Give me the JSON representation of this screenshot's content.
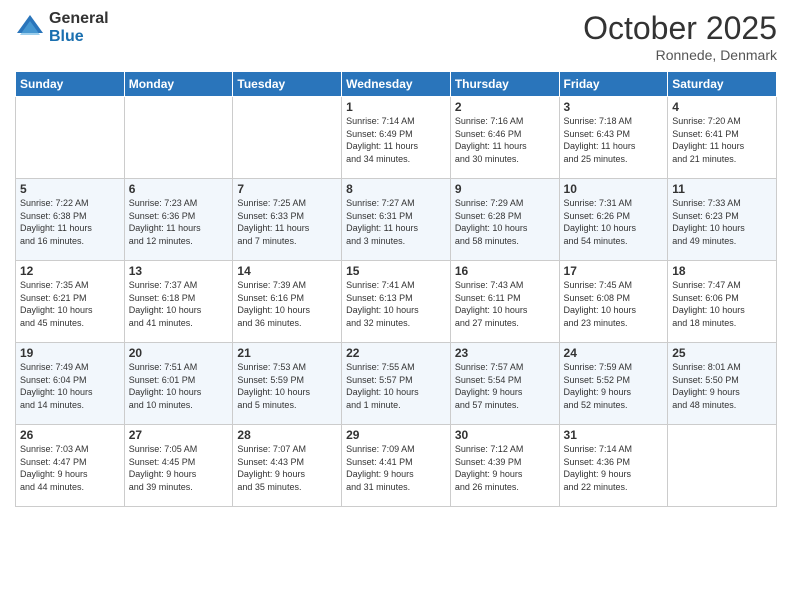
{
  "header": {
    "logo_general": "General",
    "logo_blue": "Blue",
    "month_title": "October 2025",
    "location": "Ronnede, Denmark"
  },
  "days_of_week": [
    "Sunday",
    "Monday",
    "Tuesday",
    "Wednesday",
    "Thursday",
    "Friday",
    "Saturday"
  ],
  "weeks": [
    [
      {
        "day": "",
        "info": ""
      },
      {
        "day": "",
        "info": ""
      },
      {
        "day": "",
        "info": ""
      },
      {
        "day": "1",
        "info": "Sunrise: 7:14 AM\nSunset: 6:49 PM\nDaylight: 11 hours\nand 34 minutes."
      },
      {
        "day": "2",
        "info": "Sunrise: 7:16 AM\nSunset: 6:46 PM\nDaylight: 11 hours\nand 30 minutes."
      },
      {
        "day": "3",
        "info": "Sunrise: 7:18 AM\nSunset: 6:43 PM\nDaylight: 11 hours\nand 25 minutes."
      },
      {
        "day": "4",
        "info": "Sunrise: 7:20 AM\nSunset: 6:41 PM\nDaylight: 11 hours\nand 21 minutes."
      }
    ],
    [
      {
        "day": "5",
        "info": "Sunrise: 7:22 AM\nSunset: 6:38 PM\nDaylight: 11 hours\nand 16 minutes."
      },
      {
        "day": "6",
        "info": "Sunrise: 7:23 AM\nSunset: 6:36 PM\nDaylight: 11 hours\nand 12 minutes."
      },
      {
        "day": "7",
        "info": "Sunrise: 7:25 AM\nSunset: 6:33 PM\nDaylight: 11 hours\nand 7 minutes."
      },
      {
        "day": "8",
        "info": "Sunrise: 7:27 AM\nSunset: 6:31 PM\nDaylight: 11 hours\nand 3 minutes."
      },
      {
        "day": "9",
        "info": "Sunrise: 7:29 AM\nSunset: 6:28 PM\nDaylight: 10 hours\nand 58 minutes."
      },
      {
        "day": "10",
        "info": "Sunrise: 7:31 AM\nSunset: 6:26 PM\nDaylight: 10 hours\nand 54 minutes."
      },
      {
        "day": "11",
        "info": "Sunrise: 7:33 AM\nSunset: 6:23 PM\nDaylight: 10 hours\nand 49 minutes."
      }
    ],
    [
      {
        "day": "12",
        "info": "Sunrise: 7:35 AM\nSunset: 6:21 PM\nDaylight: 10 hours\nand 45 minutes."
      },
      {
        "day": "13",
        "info": "Sunrise: 7:37 AM\nSunset: 6:18 PM\nDaylight: 10 hours\nand 41 minutes."
      },
      {
        "day": "14",
        "info": "Sunrise: 7:39 AM\nSunset: 6:16 PM\nDaylight: 10 hours\nand 36 minutes."
      },
      {
        "day": "15",
        "info": "Sunrise: 7:41 AM\nSunset: 6:13 PM\nDaylight: 10 hours\nand 32 minutes."
      },
      {
        "day": "16",
        "info": "Sunrise: 7:43 AM\nSunset: 6:11 PM\nDaylight: 10 hours\nand 27 minutes."
      },
      {
        "day": "17",
        "info": "Sunrise: 7:45 AM\nSunset: 6:08 PM\nDaylight: 10 hours\nand 23 minutes."
      },
      {
        "day": "18",
        "info": "Sunrise: 7:47 AM\nSunset: 6:06 PM\nDaylight: 10 hours\nand 18 minutes."
      }
    ],
    [
      {
        "day": "19",
        "info": "Sunrise: 7:49 AM\nSunset: 6:04 PM\nDaylight: 10 hours\nand 14 minutes."
      },
      {
        "day": "20",
        "info": "Sunrise: 7:51 AM\nSunset: 6:01 PM\nDaylight: 10 hours\nand 10 minutes."
      },
      {
        "day": "21",
        "info": "Sunrise: 7:53 AM\nSunset: 5:59 PM\nDaylight: 10 hours\nand 5 minutes."
      },
      {
        "day": "22",
        "info": "Sunrise: 7:55 AM\nSunset: 5:57 PM\nDaylight: 10 hours\nand 1 minute."
      },
      {
        "day": "23",
        "info": "Sunrise: 7:57 AM\nSunset: 5:54 PM\nDaylight: 9 hours\nand 57 minutes."
      },
      {
        "day": "24",
        "info": "Sunrise: 7:59 AM\nSunset: 5:52 PM\nDaylight: 9 hours\nand 52 minutes."
      },
      {
        "day": "25",
        "info": "Sunrise: 8:01 AM\nSunset: 5:50 PM\nDaylight: 9 hours\nand 48 minutes."
      }
    ],
    [
      {
        "day": "26",
        "info": "Sunrise: 7:03 AM\nSunset: 4:47 PM\nDaylight: 9 hours\nand 44 minutes."
      },
      {
        "day": "27",
        "info": "Sunrise: 7:05 AM\nSunset: 4:45 PM\nDaylight: 9 hours\nand 39 minutes."
      },
      {
        "day": "28",
        "info": "Sunrise: 7:07 AM\nSunset: 4:43 PM\nDaylight: 9 hours\nand 35 minutes."
      },
      {
        "day": "29",
        "info": "Sunrise: 7:09 AM\nSunset: 4:41 PM\nDaylight: 9 hours\nand 31 minutes."
      },
      {
        "day": "30",
        "info": "Sunrise: 7:12 AM\nSunset: 4:39 PM\nDaylight: 9 hours\nand 26 minutes."
      },
      {
        "day": "31",
        "info": "Sunrise: 7:14 AM\nSunset: 4:36 PM\nDaylight: 9 hours\nand 22 minutes."
      },
      {
        "day": "",
        "info": ""
      }
    ]
  ]
}
